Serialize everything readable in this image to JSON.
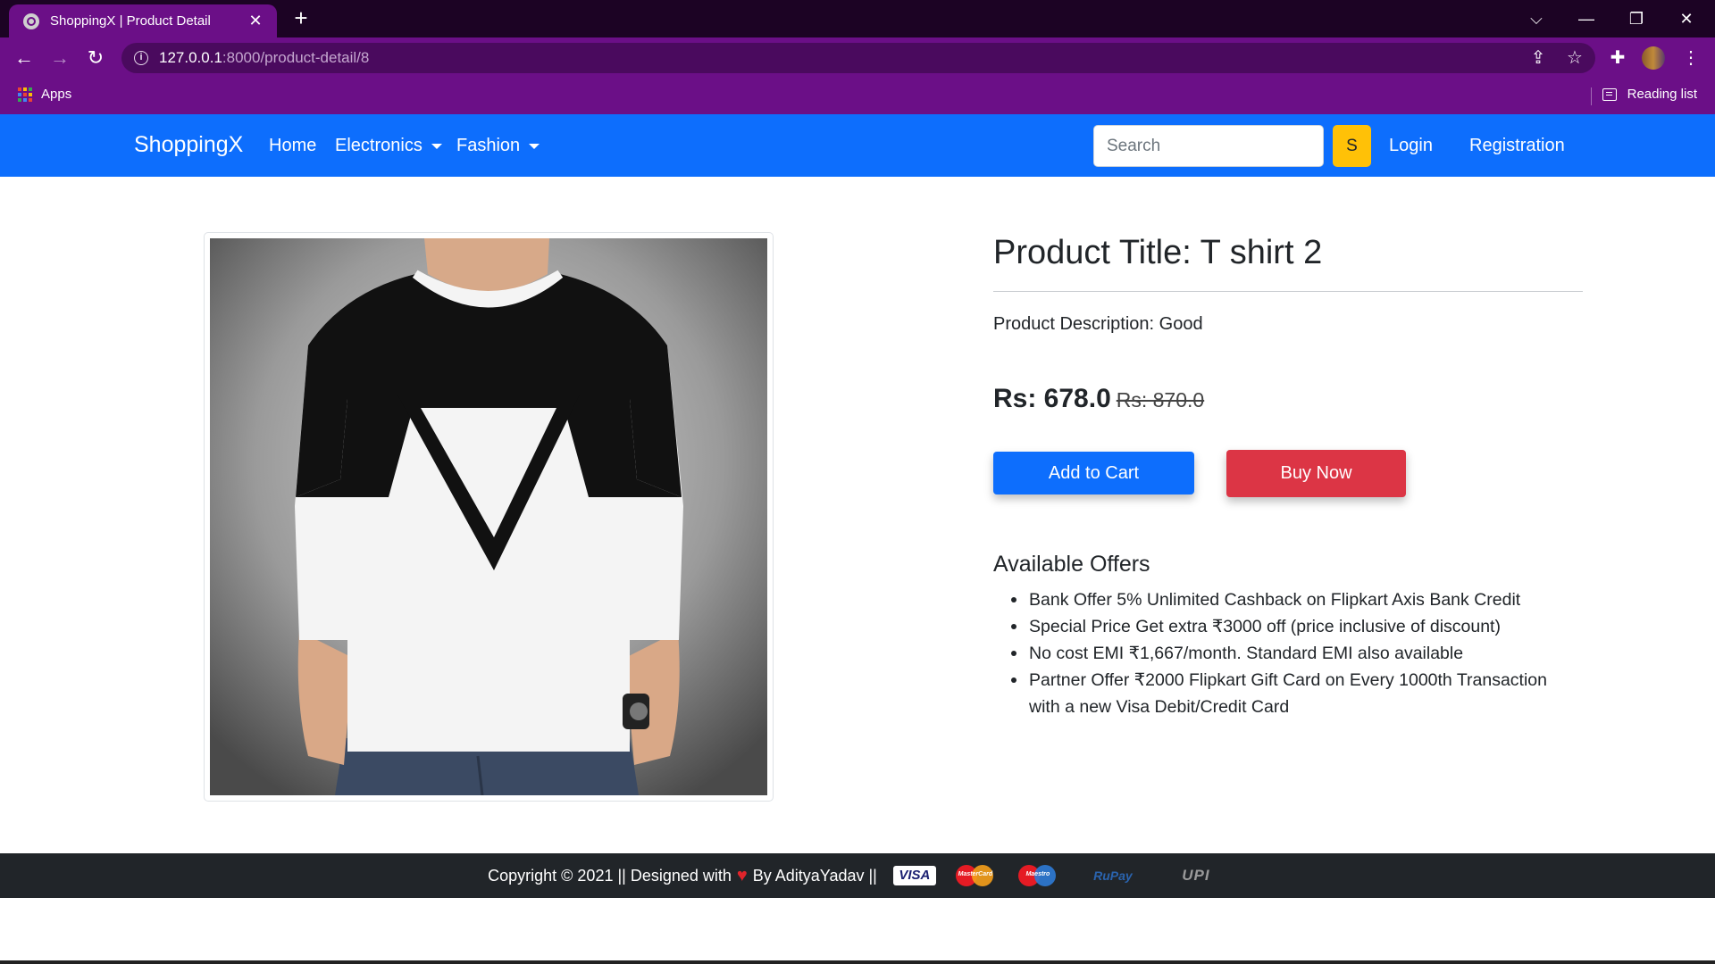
{
  "browser": {
    "tab_title": "ShoppingX | Product Detail",
    "url_host": "127.0.0.1",
    "url_path": ":8000/product-detail/8",
    "bookmark_apps": "Apps",
    "reading_list": "Reading list"
  },
  "navbar": {
    "brand": "ShoppingX",
    "home": "Home",
    "electronics": "Electronics",
    "fashion": "Fashion",
    "search_placeholder": "Search",
    "search_button": "S",
    "login": "Login",
    "registration": "Registration",
    "color": "#0d6efd"
  },
  "product": {
    "title": "Product Title: T shirt 2",
    "description": "Product Description: Good",
    "price": "Rs: 678.0",
    "old_price": "Rs: 870.0",
    "add_to_cart": "Add to Cart",
    "buy_now": "Buy Now",
    "image_icon": "tshirt-photo"
  },
  "offers": {
    "title": "Available Offers",
    "items": [
      "Bank Offer 5% Unlimited Cashback on Flipkart Axis Bank Credit",
      "Special Price Get extra ₹3000 off (price inclusive of discount)",
      "No cost EMI ₹1,667/month. Standard EMI also available",
      "Partner Offer ₹2000 Flipkart Gift Card on Every 1000th Transaction with a new Visa Debit/Credit Card"
    ]
  },
  "footer": {
    "text": "Copyright © 2021 || Designed with",
    "by": "By AdityaYadav ||",
    "payment_icons": [
      "visa",
      "mastercard",
      "maestro",
      "rupay",
      "upi"
    ],
    "visa": "VISA",
    "mastercard": "MasterCard",
    "maestro": "Maestro",
    "rupay": "RuPay",
    "upi": "UPI"
  }
}
